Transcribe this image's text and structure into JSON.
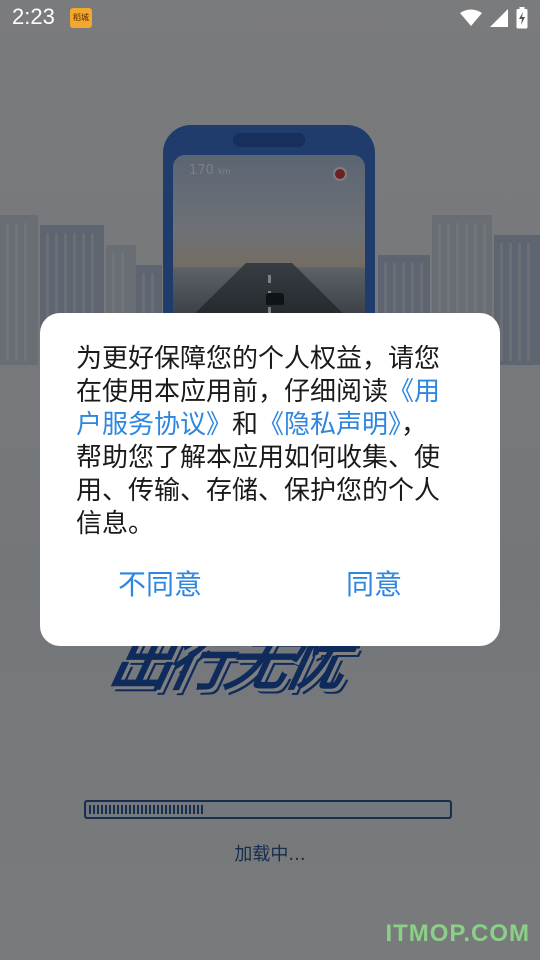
{
  "status_bar": {
    "time": "2:23",
    "notification_icon_text": "稻城",
    "icons": [
      "wifi-icon",
      "cell-signal-icon",
      "battery-charging-icon"
    ]
  },
  "splash": {
    "phone_speed": "170",
    "phone_speed_unit": "km",
    "logo_text": "出行无忧",
    "progress_fraction": 0.32,
    "loading_text": "加载中...",
    "watermark": "ITMOP.COM"
  },
  "dialog": {
    "text_part1": "为更好保障您的个人权益，请您在使用本应用前，仔细阅读",
    "link_user_agreement": "《用户服务协议》",
    "text_and": "和",
    "link_privacy": "《隐私声明》",
    "text_part2": "，帮助您了解本应用如何收集、使用、传输、存储、保护您的个人信息。",
    "disagree_label": "不同意",
    "agree_label": "同意"
  },
  "colors": {
    "accent": "#2d86e0",
    "brand_blue": "#1d57b9",
    "overlay": "rgba(0,0,0,0.5)"
  }
}
